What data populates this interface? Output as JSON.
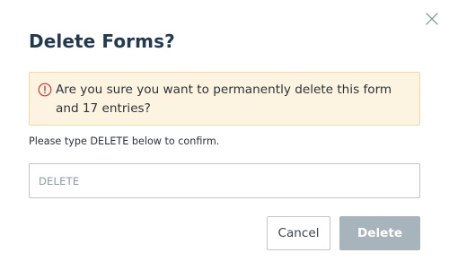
{
  "dialog": {
    "title": "Delete Forms?",
    "close_icon": "close-icon",
    "warning": {
      "icon": "alert-circle-icon",
      "color": "#d63638",
      "text": "Are you sure you want to permanently delete this form and 17 entries?"
    },
    "instruction": "Please type DELETE below to confirm.",
    "input": {
      "value": "",
      "placeholder": "DELETE"
    },
    "buttons": {
      "cancel_label": "Cancel",
      "delete_label": "Delete",
      "delete_disabled": true
    }
  }
}
